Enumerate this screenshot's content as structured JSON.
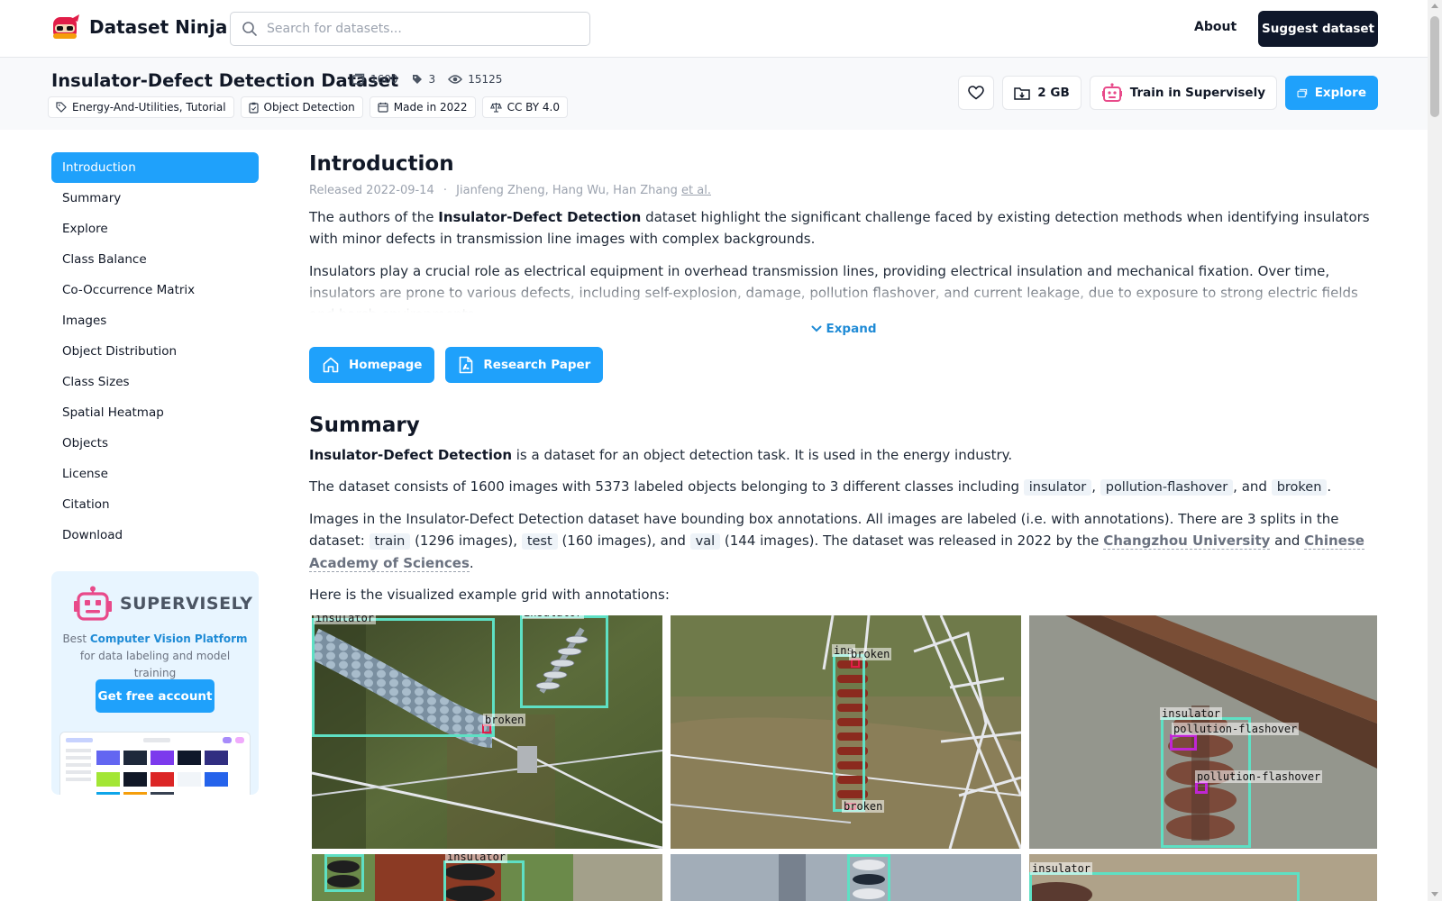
{
  "nav": {
    "brand": "Dataset Ninja",
    "search_placeholder": "Search for datasets...",
    "about": "About",
    "suggest": "Suggest dataset"
  },
  "dataset": {
    "title": "Insulator-Defect Detection Dataset",
    "stats": {
      "images": "1600",
      "classes": "3",
      "views": "15125"
    },
    "tags": [
      "Energy-And-Utilities, Tutorial",
      "Object Detection",
      "Made in 2022",
      "CC BY 4.0"
    ],
    "actions": {
      "size": "2 GB",
      "train": "Train in Supervisely",
      "explore": "Explore"
    }
  },
  "sidebar": {
    "items": [
      {
        "label": "Introduction",
        "active": true
      },
      {
        "label": "Summary"
      },
      {
        "label": "Explore"
      },
      {
        "label": "Class Balance"
      },
      {
        "label": "Co-Occurrence Matrix"
      },
      {
        "label": "Images"
      },
      {
        "label": "Object Distribution"
      },
      {
        "label": "Class Sizes"
      },
      {
        "label": "Spatial Heatmap"
      },
      {
        "label": "Objects"
      },
      {
        "label": "License"
      },
      {
        "label": "Citation"
      },
      {
        "label": "Download"
      }
    ],
    "promo": {
      "brand": "SUPERVISELY",
      "text_pre": "Best ",
      "text_link": "Computer Vision Platform",
      "text_post": " for data labeling and model training",
      "button": "Get free account"
    }
  },
  "intro": {
    "heading": "Introduction",
    "released": "Released 2022-09-14",
    "sep": "·",
    "authors": "Jianfeng Zheng, Hang Wu, Han Zhang",
    "etal": "et al.",
    "p1_pre": "The authors of the ",
    "p1_bold": "Insulator-Defect Detection",
    "p1_post": " dataset highlight the significant challenge faced by existing detection methods when identifying insulators with minor defects in transmission line images with complex backgrounds.",
    "p2": "Insulators play a crucial role as electrical equipment in overhead transmission lines, providing electrical insulation and mechanical fixation. Over time, insulators are prone to various defects, including self-explosion, damage, pollution flashover, and current leakage, due to exposure to strong electric fields and harsh environments.",
    "expand": "Expand",
    "homepage": "Homepage",
    "paper": "Research Paper"
  },
  "summary": {
    "heading": "Summary",
    "s1_bold": "Insulator-Defect Detection",
    "s1_post": " is a dataset for an object detection task. It is used in the energy industry.",
    "s2_pre": "The dataset consists of 1600 images with 5373 labeled objects belonging to 3 different classes including ",
    "classes": [
      "insulator",
      "pollution-flashover",
      "broken"
    ],
    "sep_comma": ", ",
    "sep_and": ", and ",
    "period": ".",
    "s3_pre": "Images in the Insulator-Defect Detection dataset have bounding box annotations. All images are labeled (i.e. with annotations). There are 3 splits in the dataset: ",
    "splits": [
      {
        "name": "train",
        "count": " (1296 images), "
      },
      {
        "name": "test",
        "count": " (160 images), and "
      },
      {
        "name": "val",
        "count": " (144 images)"
      }
    ],
    "s3_mid": ". The dataset was released in 2022 by the ",
    "org1": "Changzhou University",
    "and": " and ",
    "org2": "Chinese Academy of Sciences",
    "s4": "Here is the visualized example grid with annotations:"
  },
  "grid": {
    "labels": {
      "insulator": "insulator",
      "broken": "broken",
      "pollution": "pollution-flashover",
      "ins": "ins"
    }
  },
  "colors": {
    "accent": "#1fa1fb",
    "dark": "#0f172a",
    "bbox_insulator": "#5ee0c4",
    "bbox_broken": "#e11d48",
    "bbox_pollution": "#c026d3"
  }
}
